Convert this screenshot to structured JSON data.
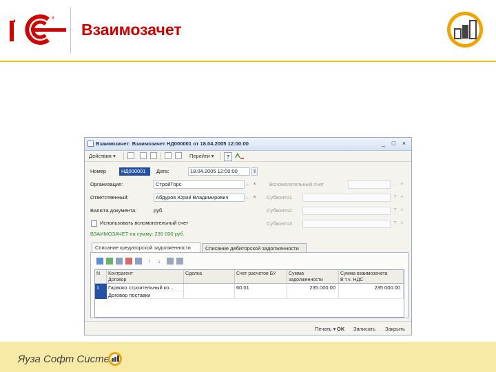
{
  "slide": {
    "title": "Взаимозачет",
    "footer_text": "Яуза Софт Системз",
    "accent_colors": {
      "title": "#d40000",
      "header_line": "#f2c20e",
      "footer_bg": "#f6eaa6",
      "logo_orange": "#f0a400"
    }
  },
  "window": {
    "title": "Взаимозачет: Взаимозачет НД000001 от 18.04.2005 12:00:00",
    "buttons": {
      "minimize": "_",
      "maximize": "□",
      "close": "×"
    },
    "toolbar": {
      "actions_label": "Действия ▾",
      "goto_label": "Перейти ▾",
      "help_icon": "?"
    },
    "form": {
      "number_label": "Номер",
      "number_value": "НД000001",
      "date_label": "Дата:",
      "date_value": "18.04.2005 12:00:00",
      "org_label": "Организация:",
      "org_value": "СтройТорс",
      "responsible_label": "Ответственный:",
      "responsible_value": "Абдуров Юрий Владимирович",
      "currency_label": "Валюта документа:",
      "currency_value": "руб.",
      "aux_account_label": "Вспомогательный счет",
      "subconto1_label": "Субконто1",
      "subconto2_label": "Субконто2",
      "subconto3_label": "Субконто3",
      "checkbox_label": "Использовать вспомогательный счет",
      "total_text": "ВЗАИМОЗАЧЕТ на сумму: 235 000 руб."
    },
    "tabs": [
      {
        "label": "Списание кредиторской задолженности"
      },
      {
        "label": "Списание дебиторской задолженности"
      }
    ],
    "table": {
      "columns": [
        "N",
        "Контрагент",
        "Сделка",
        "Счет расчетов БУ",
        "Сумма задолженности",
        "Сумма взаимозачета"
      ],
      "subcolumns": {
        "contractor_sub": "Договор",
        "offset_sub": "В т.ч. НДС"
      },
      "rows": [
        {
          "n": "1",
          "contractor": "Гарвоко строительный ко...",
          "contract": "Договор поставки",
          "deal": "",
          "account": "60.01",
          "debt": "235 000.00",
          "offset": "235 000.00"
        }
      ]
    },
    "bottom_buttons": {
      "print": "Печать ▾",
      "ok": "OK",
      "save": "Записать",
      "close": "Закрыть"
    }
  }
}
